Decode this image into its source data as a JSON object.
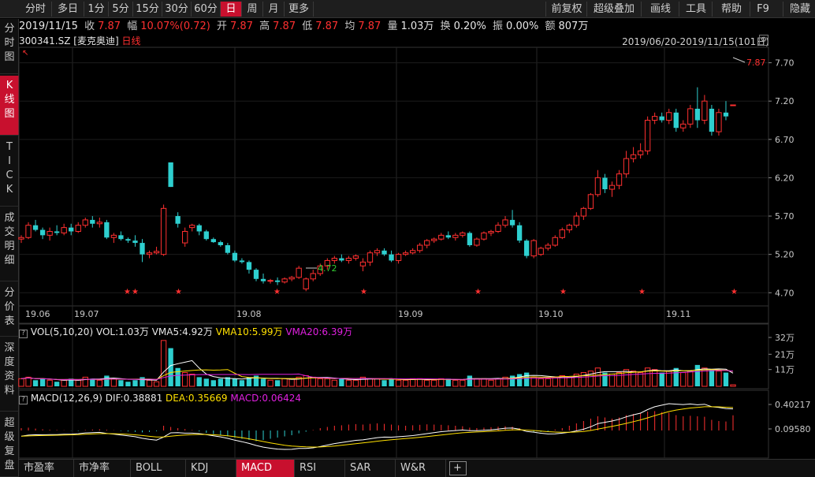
{
  "toolbar": {
    "period_buttons": [
      "分时",
      "多日",
      "1分",
      "5分",
      "15分",
      "30分",
      "60分",
      "日",
      "周",
      "月",
      "更多"
    ],
    "active_period": "日",
    "right_buttons": [
      "前复权",
      "超级叠加",
      "画线",
      "工具",
      "帮助",
      "F9",
      "隐藏"
    ]
  },
  "sidebar": {
    "items": [
      "分时图",
      "K线图",
      "TICK",
      "成交明细",
      "分价表",
      "深度资料",
      "超级复盘"
    ],
    "active": "K线图"
  },
  "quote": {
    "date": "2019/11/15",
    "close_label": "收",
    "close": "7.87",
    "change_label": "幅",
    "change": "10.07%(0.72)",
    "open_label": "开",
    "open": "7.87",
    "high_label": "高",
    "high": "7.87",
    "low_label": "低",
    "low": "7.87",
    "avg_label": "均",
    "avg": "7.87",
    "volume_label": "量",
    "volume": "1.03万",
    "turnover_label": "换",
    "turnover": "0.20%",
    "amplitude_label": "振",
    "amplitude": "0.00%",
    "amount_label": "额",
    "amount": "807万"
  },
  "stock": {
    "code": "300341.SZ",
    "name": "[麦克奥迪]",
    "period_label": "日线",
    "range": "2019/06/20-2019/11/15(101日)"
  },
  "kline": {
    "y_ticks": [
      "7.70",
      "7.20",
      "6.70",
      "6.20",
      "5.70",
      "5.20",
      "4.70"
    ],
    "x_ticks": [
      "19.06",
      "19.07",
      "19.08",
      "19.09",
      "19.10",
      "19.11"
    ],
    "marker_high": "7.87",
    "marker_low": "4.72"
  },
  "volume_panel": {
    "title": "VOL(5,10,20)",
    "vol": "VOL:1.03万",
    "vma5": "VMA5:4.92万",
    "vma10": "VMA10:5.99万",
    "vma20": "VMA20:6.39万",
    "y_ticks": [
      "32万",
      "21万",
      "11万"
    ]
  },
  "macd_panel": {
    "title": "MACD(12,26,9)",
    "dif": "DIF:0.38881",
    "dea": "DEA:0.35669",
    "macd": "MACD:0.06424",
    "y_ticks": [
      "0.40217",
      "0.09580"
    ]
  },
  "bottom_tabs": [
    "市盈率",
    "市净率",
    "BOLL",
    "KDJ",
    "MACD",
    "RSI",
    "SAR",
    "W&R"
  ],
  "active_tab": "MACD",
  "colors": {
    "up": "#ff3030",
    "down": "#2ecfcf",
    "active": "#c8102e",
    "vma5": "#ffffff",
    "vma10": "#ffe000",
    "vma20": "#e020e0"
  },
  "chart_data": {
    "type": "candlestick",
    "y_range": [
      4.6,
      7.85
    ],
    "candles_ohlc": [
      [
        5.4,
        5.45,
        5.35,
        5.42
      ],
      [
        5.42,
        5.62,
        5.4,
        5.58
      ],
      [
        5.58,
        5.65,
        5.5,
        5.52
      ],
      [
        5.52,
        5.55,
        5.4,
        5.45
      ],
      [
        5.45,
        5.55,
        5.38,
        5.5
      ],
      [
        5.5,
        5.58,
        5.45,
        5.48
      ],
      [
        5.48,
        5.6,
        5.45,
        5.55
      ],
      [
        5.55,
        5.6,
        5.45,
        5.5
      ],
      [
        5.5,
        5.62,
        5.48,
        5.58
      ],
      [
        5.58,
        5.68,
        5.55,
        5.65
      ],
      [
        5.65,
        5.7,
        5.55,
        5.6
      ],
      [
        5.6,
        5.68,
        5.55,
        5.62
      ],
      [
        5.62,
        5.65,
        5.4,
        5.42
      ],
      [
        5.42,
        5.48,
        5.35,
        5.45
      ],
      [
        5.45,
        5.5,
        5.38,
        5.4
      ],
      [
        5.4,
        5.42,
        5.35,
        5.38
      ],
      [
        5.38,
        5.45,
        5.3,
        5.35
      ],
      [
        5.35,
        5.4,
        5.1,
        5.2
      ],
      [
        5.2,
        5.25,
        5.15,
        5.22
      ],
      [
        5.22,
        5.3,
        5.2,
        5.24
      ],
      [
        5.2,
        5.85,
        5.18,
        5.8
      ],
      [
        6.4,
        6.4,
        6.08,
        6.08
      ],
      [
        5.7,
        5.75,
        5.55,
        5.6
      ],
      [
        5.35,
        5.55,
        5.3,
        5.5
      ],
      [
        5.55,
        5.6,
        5.5,
        5.58
      ],
      [
        5.58,
        5.6,
        5.45,
        5.5
      ],
      [
        5.5,
        5.52,
        5.38,
        5.4
      ],
      [
        5.4,
        5.42,
        5.35,
        5.36
      ],
      [
        5.36,
        5.38,
        5.3,
        5.32
      ],
      [
        5.32,
        5.35,
        5.2,
        5.22
      ],
      [
        5.22,
        5.25,
        5.1,
        5.12
      ],
      [
        5.12,
        5.15,
        5.08,
        5.1
      ],
      [
        5.1,
        5.12,
        4.95,
        5.0
      ],
      [
        5.0,
        5.02,
        4.85,
        4.88
      ],
      [
        4.88,
        4.95,
        4.82,
        4.85
      ],
      [
        4.85,
        4.88,
        4.82,
        4.86
      ],
      [
        4.86,
        4.9,
        4.8,
        4.84
      ],
      [
        4.84,
        4.9,
        4.82,
        4.88
      ],
      [
        4.88,
        4.92,
        4.85,
        4.9
      ],
      [
        4.9,
        5.05,
        4.88,
        5.02
      ],
      [
        4.75,
        4.9,
        4.72,
        4.88
      ],
      [
        4.88,
        5.0,
        4.85,
        4.95
      ],
      [
        4.95,
        5.08,
        4.92,
        5.05
      ],
      [
        5.05,
        5.15,
        5.0,
        5.12
      ],
      [
        5.12,
        5.18,
        5.08,
        5.15
      ],
      [
        5.15,
        5.2,
        5.1,
        5.12
      ],
      [
        5.12,
        5.18,
        5.08,
        5.15
      ],
      [
        5.15,
        5.2,
        5.12,
        5.18
      ],
      [
        5.05,
        5.15,
        4.98,
        5.1
      ],
      [
        5.1,
        5.25,
        5.05,
        5.22
      ],
      [
        5.22,
        5.28,
        5.18,
        5.25
      ],
      [
        5.25,
        5.28,
        5.18,
        5.2
      ],
      [
        5.2,
        5.25,
        5.1,
        5.12
      ],
      [
        5.12,
        5.22,
        5.08,
        5.2
      ],
      [
        5.2,
        5.25,
        5.18,
        5.22
      ],
      [
        5.22,
        5.28,
        5.2,
        5.25
      ],
      [
        5.25,
        5.35,
        5.22,
        5.32
      ],
      [
        5.32,
        5.4,
        5.28,
        5.38
      ],
      [
        5.38,
        5.42,
        5.35,
        5.4
      ],
      [
        5.4,
        5.48,
        5.38,
        5.45
      ],
      [
        5.45,
        5.5,
        5.4,
        5.42
      ],
      [
        5.42,
        5.48,
        5.38,
        5.45
      ],
      [
        5.45,
        5.5,
        5.42,
        5.48
      ],
      [
        5.48,
        5.5,
        5.3,
        5.32
      ],
      [
        5.32,
        5.42,
        5.3,
        5.4
      ],
      [
        5.4,
        5.5,
        5.38,
        5.48
      ],
      [
        5.48,
        5.52,
        5.44,
        5.5
      ],
      [
        5.5,
        5.62,
        5.48,
        5.58
      ],
      [
        5.58,
        5.7,
        5.55,
        5.65
      ],
      [
        5.65,
        5.78,
        5.55,
        5.58
      ],
      [
        5.58,
        5.62,
        5.35,
        5.38
      ],
      [
        5.38,
        5.4,
        5.15,
        5.18
      ],
      [
        5.18,
        5.4,
        5.15,
        5.38
      ],
      [
        5.2,
        5.3,
        5.18,
        5.28
      ],
      [
        5.28,
        5.35,
        5.25,
        5.32
      ],
      [
        5.32,
        5.45,
        5.3,
        5.42
      ],
      [
        5.42,
        5.55,
        5.4,
        5.52
      ],
      [
        5.52,
        5.6,
        5.48,
        5.58
      ],
      [
        5.58,
        5.75,
        5.55,
        5.7
      ],
      [
        5.7,
        5.82,
        5.65,
        5.8
      ],
      [
        5.8,
        6.0,
        5.78,
        5.98
      ],
      [
        5.98,
        6.3,
        5.95,
        6.2
      ],
      [
        6.2,
        6.25,
        6.0,
        6.05
      ],
      [
        6.05,
        6.15,
        5.95,
        6.1
      ],
      [
        6.1,
        6.3,
        6.05,
        6.25
      ],
      [
        6.25,
        6.55,
        6.2,
        6.45
      ],
      [
        6.45,
        6.6,
        6.4,
        6.5
      ],
      [
        6.5,
        6.65,
        6.45,
        6.55
      ],
      [
        6.55,
        7.0,
        6.5,
        6.95
      ],
      [
        6.95,
        7.05,
        6.9,
        7.0
      ],
      [
        7.0,
        7.05,
        6.92,
        6.95
      ],
      [
        6.95,
        7.1,
        6.9,
        7.05
      ],
      [
        7.05,
        7.1,
        6.8,
        6.85
      ],
      [
        6.85,
        6.95,
        6.8,
        6.9
      ],
      [
        6.9,
        7.15,
        6.85,
        7.1
      ],
      [
        7.1,
        7.38,
        6.85,
        6.95
      ],
      [
        6.95,
        7.28,
        6.9,
        7.2
      ],
      [
        7.1,
        7.15,
        6.75,
        6.8
      ],
      [
        6.8,
        7.1,
        6.75,
        7.05
      ],
      [
        7.05,
        7.2,
        6.95,
        7.0
      ],
      [
        7.15,
        7.15,
        7.15,
        7.15
      ]
    ],
    "volumes_wan": [
      5,
      6,
      4,
      5,
      4,
      3,
      4,
      5,
      4,
      6,
      5,
      4,
      7,
      5,
      4,
      3,
      4,
      6,
      4,
      3,
      30,
      25,
      12,
      9,
      8,
      6,
      5,
      4,
      5,
      6,
      5,
      4,
      6,
      7,
      5,
      4,
      4,
      5,
      5,
      6,
      7,
      6,
      5,
      5,
      4,
      5,
      4,
      4,
      6,
      5,
      5,
      4,
      5,
      4,
      4,
      5,
      5,
      4,
      4,
      5,
      5,
      4,
      4,
      7,
      5,
      5,
      4,
      5,
      6,
      7,
      8,
      9,
      6,
      5,
      5,
      6,
      7,
      6,
      8,
      9,
      10,
      12,
      9,
      8,
      9,
      11,
      10,
      9,
      12,
      11,
      9,
      10,
      12,
      9,
      10,
      14,
      12,
      11,
      10,
      9,
      1
    ],
    "macd_hist": [
      0.01,
      0.012,
      0.008,
      0.005,
      0.003,
      0.002,
      0.001,
      -0.001,
      -0.002,
      0.002,
      0.004,
      0.005,
      0.003,
      0.001,
      -0.002,
      -0.004,
      -0.006,
      -0.008,
      -0.006,
      -0.003,
      0.02,
      0.015,
      0.01,
      0.006,
      0.002,
      -0.004,
      -0.01,
      -0.015,
      -0.02,
      -0.025,
      -0.03,
      -0.035,
      -0.04,
      -0.045,
      -0.04,
      -0.035,
      -0.03,
      -0.025,
      -0.02,
      -0.012,
      -0.005,
      0.002,
      0.01,
      0.015,
      0.02,
      0.022,
      0.025,
      0.027,
      0.025,
      0.028,
      0.03,
      0.028,
      0.025,
      0.022,
      0.02,
      0.022,
      0.024,
      0.026,
      0.025,
      0.024,
      0.022,
      0.02,
      0.018,
      0.012,
      0.01,
      0.012,
      0.014,
      0.016,
      0.018,
      0.016,
      0.01,
      0.002,
      -0.005,
      -0.006,
      -0.004,
      0.004,
      0.01,
      0.02,
      0.03,
      0.04,
      0.05,
      0.06,
      0.055,
      0.05,
      0.055,
      0.065,
      0.07,
      0.072,
      0.08,
      0.082,
      0.078,
      0.075,
      0.065,
      0.06,
      0.062,
      0.06,
      0.058,
      0.045,
      0.04,
      0.038,
      0.064
    ]
  }
}
